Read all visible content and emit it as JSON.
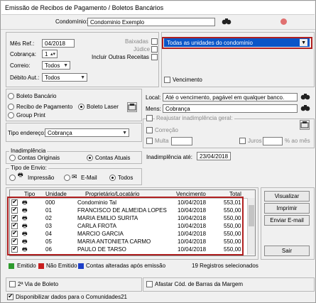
{
  "window": {
    "title": "Emissão de Recibos de Pagamento / Boletos Bancários"
  },
  "condominio": {
    "label": "Condomínio:",
    "value": "Condominio Exemplo"
  },
  "params": {
    "mes_ref_label": "Mês Ref.:",
    "mes_ref_value": "04/2018",
    "cobranca_label": "Cobrança:",
    "cobranca_value": "1",
    "correio_label": "Correio:",
    "correio_value": "Todos",
    "debito_label": "Débito Aut.:",
    "debito_value": "Todos",
    "baixadas_label": "Baixadas",
    "judice_label": "Júdice",
    "outras_receitas_label": "Incluir Outras Receitas"
  },
  "unidades": {
    "value": "Todas as unidades do condominio",
    "vencimento_label": "Vencimento"
  },
  "boleto": {
    "bancario_label": "Boleto Bancário",
    "recibo_label": "Recibo de Pagamento",
    "laser_label": "Boleto Laser",
    "group_label": "Group Print"
  },
  "local": {
    "label": "Local:",
    "value": "Até o vencimento, pagável em qualquer banco.",
    "mens_label": "Mens:",
    "mens_value": "Cobrança"
  },
  "tipo_endereco": {
    "label": "Tipo endereço:",
    "value": "Cobrança"
  },
  "reajustar": {
    "label": "Reajustar inadimplência geral:",
    "correcao_label": "Correção",
    "multa_label": "Multa",
    "juros_label": "Juros",
    "ao_mes_label": "% ao mês"
  },
  "inadimplencia": {
    "title": "Inadimplência",
    "originais_label": "Contas Originais",
    "atuais_label": "Contas Atuais",
    "ate_label": "Inadimplência até:",
    "ate_value": "23/04/2018"
  },
  "envio": {
    "title": "Tipo de Envio:",
    "impressao_label": "Impressão",
    "email_label": "E-Mail",
    "todos_label": "Todos"
  },
  "table": {
    "headers": {
      "tipo": "Tipo",
      "unidade": "Unidade",
      "proprietario": "Proprietário/Locatário",
      "vencimento": "Vencimento",
      "total": "Total"
    },
    "rows": [
      {
        "unidade": "000",
        "nome": "Condominio Tal",
        "venc": "10/04/2018",
        "total": "553,01"
      },
      {
        "unidade": "01",
        "nome": "FRANCISCO DE ALMEIDA LOPES",
        "venc": "10/04/2018",
        "total": "550,00"
      },
      {
        "unidade": "02",
        "nome": "MARIA EMILIO SURITA",
        "venc": "10/04/2018",
        "total": "550,00"
      },
      {
        "unidade": "03",
        "nome": "CARLA FROTA",
        "venc": "10/04/2018",
        "total": "550,00"
      },
      {
        "unidade": "04",
        "nome": "MARCIO GARCIA",
        "venc": "10/04/2018",
        "total": "550,00"
      },
      {
        "unidade": "05",
        "nome": "MARIA ANTONIETA CARMO",
        "venc": "10/04/2018",
        "total": "550,00"
      },
      {
        "unidade": "06",
        "nome": "PAULO DE TARSO",
        "venc": "10/04/2018",
        "total": "550,00"
      }
    ]
  },
  "actions": {
    "visualizar": "Visualizar",
    "imprimir": "Imprimir",
    "enviar_email": "Enviar E-mail",
    "sair": "Sair"
  },
  "legend": {
    "emitido": "Emitido",
    "nao_emitido": "Não Emitido",
    "contas_alteradas": "Contas alteradas após emissão",
    "registros": "19 Registros selecionados",
    "colors": {
      "emitido": "#2e9b2e",
      "nao_emitido": "#c81e1e",
      "alteradas": "#1e3fc8"
    }
  },
  "footer": {
    "segunda_via": "2ª Via de Boleto",
    "afastar": "Afastar Cód. de Barras da Margem",
    "disponibilizar": "Disponibilizar dados para o Comunidades21"
  }
}
